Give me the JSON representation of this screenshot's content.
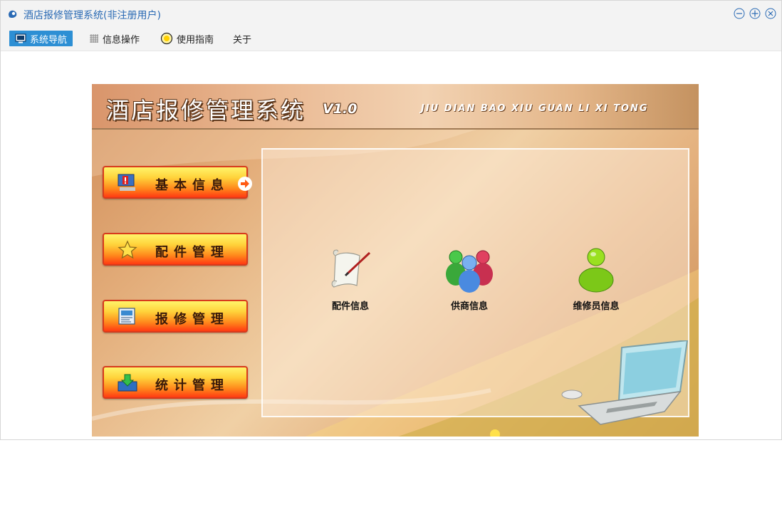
{
  "window": {
    "title": "酒店报修管理系统(非注册用户)"
  },
  "menu": {
    "items": [
      {
        "label": "系统导航",
        "icon": "monitor-icon",
        "active": true
      },
      {
        "label": "信息操作",
        "icon": "grid-icon",
        "active": false
      },
      {
        "label": "使用指南",
        "icon": "bulb-icon",
        "active": false
      },
      {
        "label": "关于",
        "icon": "",
        "active": false
      }
    ]
  },
  "banner": {
    "title": "酒店报修管理系统",
    "version": "V1.0",
    "pinyin": "JIU DIAN BAO XIU GUAN LI XI TONG"
  },
  "nav": {
    "buttons": [
      {
        "label": "基本信息",
        "icon": "warning-monitor-icon"
      },
      {
        "label": "配件管理",
        "icon": "star-icon"
      },
      {
        "label": "报修管理",
        "icon": "form-icon"
      },
      {
        "label": "统计管理",
        "icon": "download-tray-icon"
      }
    ]
  },
  "panel": {
    "items": [
      {
        "label": "配件信息",
        "icon": "scroll-pen-icon"
      },
      {
        "label": "供商信息",
        "icon": "users-group-icon"
      },
      {
        "label": "维修员信息",
        "icon": "user-green-icon"
      }
    ]
  },
  "colors": {
    "accent": "#2d8fd4",
    "title": "#2a6ab4",
    "button_border": "#d83a1c"
  }
}
